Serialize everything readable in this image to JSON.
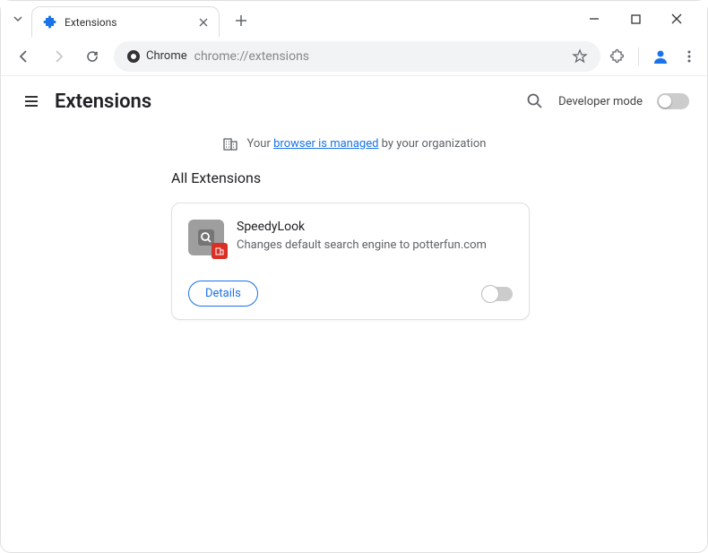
{
  "tab": {
    "title": "Extensions"
  },
  "addressbar": {
    "chip": "Chrome",
    "url": "chrome://extensions"
  },
  "page": {
    "title": "Extensions",
    "dev_mode_label": "Developer mode"
  },
  "managed": {
    "prefix": "Your ",
    "link": "browser is managed",
    "suffix": " by your organization"
  },
  "section": {
    "title": "All Extensions"
  },
  "extension": {
    "name": "SpeedyLook",
    "description": "Changes default search engine to potterfun.com",
    "details_label": "Details"
  }
}
